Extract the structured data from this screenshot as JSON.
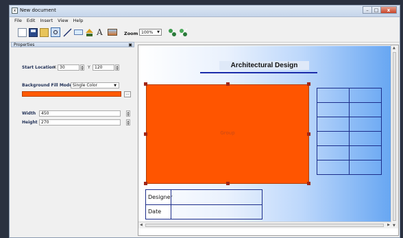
{
  "window": {
    "title": "New document",
    "app_icon": "document-icon"
  },
  "menu": [
    "File",
    "Edit",
    "Insert",
    "View",
    "Help"
  ],
  "toolbar": {
    "zoom_label": "Zoom",
    "zoom_value": "100%"
  },
  "properties": {
    "header": "Properties",
    "start_location_label": "Start Location",
    "x_label": "X",
    "x_value": "30",
    "y_label": "Y",
    "y_value": "120",
    "fill_mode_label": "Background Fill Mode",
    "fill_mode_value": "Single Color",
    "fill_color": "#ff5a00",
    "width_label": "Width",
    "width_value": "450",
    "height_label": "Height",
    "height_value": "270"
  },
  "canvas": {
    "title": "Architectural Design",
    "shape_label": "Group",
    "shape_color": "#ff5500",
    "underline_color": "#1b2caa",
    "info_table": [
      {
        "label": "Designer",
        "value": ""
      },
      {
        "label": "Date",
        "value": ""
      }
    ]
  }
}
